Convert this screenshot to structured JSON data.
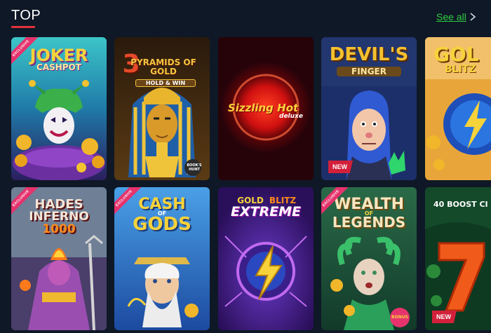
{
  "section": {
    "title": "TOP",
    "see_all_label": "See all",
    "chevron_icon": "chevron-right-icon"
  },
  "colors": {
    "background": "#0f1826",
    "accent_underline": "#e0323c",
    "link": "#2ecc40",
    "new_badge": "#d3203a",
    "exclusive_ribbon": "#e6336d"
  },
  "games": [
    {
      "title": "JOKER",
      "subtitle": "CASHPOT",
      "ribbon": "EXCLUSIVE",
      "badge": ""
    },
    {
      "title": "3",
      "subtitle": "PYRAMIDS OF GOLD",
      "tag": "HOLD & WIN",
      "provider": "BOOK'S HUNT",
      "ribbon": "",
      "badge": ""
    },
    {
      "title": "Sizzling Hot",
      "subtitle": "deluxe",
      "ribbon": "",
      "badge": ""
    },
    {
      "title": "DEVIL'S",
      "subtitle": "FINGER",
      "ribbon": "",
      "badge": "NEW"
    },
    {
      "title": "GOL",
      "subtitle": "BLITZ",
      "ribbon": "",
      "badge": ""
    },
    {
      "title": "HADES",
      "subtitle": "INFERNO",
      "number": "1000",
      "ribbon": "EXCLUSIVE",
      "badge": ""
    },
    {
      "title": "CASH",
      "of": "OF",
      "subtitle": "GODS",
      "ribbon": "EXCLUSIVE",
      "badge": ""
    },
    {
      "title": "GOLD",
      "title2": "BLITZ",
      "subtitle": "EXTREME",
      "ribbon": "",
      "badge": ""
    },
    {
      "title": "WEALTH",
      "of": "OF",
      "subtitle": "LEGENDS",
      "corner": "BONUS",
      "ribbon": "EXCLUSIVE",
      "badge": ""
    },
    {
      "title": "40 BOOST CI",
      "ribbon": "",
      "badge": "NEW"
    }
  ]
}
